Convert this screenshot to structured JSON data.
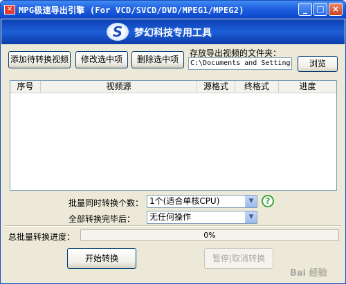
{
  "window": {
    "icon_glyph": "✕",
    "title": "MPG极速导出引擎 (For VCD/SVCD/DVD/MPEG1/MPEG2)",
    "minimize_glyph": "_",
    "maximize_glyph": "□",
    "close_glyph": "×"
  },
  "banner": {
    "logo_glyph": "S",
    "text": "梦幻科技专用工具"
  },
  "toolbar": {
    "add_label": "添加待转换视频",
    "edit_label": "修改选中项",
    "delete_label": "删除选中项"
  },
  "output": {
    "folder_label": "存放导出视频的文件夹：",
    "folder_value": "C:\\Documents and Settings",
    "browse_label": "浏览"
  },
  "list": {
    "columns": [
      "序号",
      "视频源",
      "源格式",
      "终格式",
      "进度"
    ],
    "rows": []
  },
  "options": {
    "concurrent_label": "批量同时转换个数：",
    "concurrent_value": "1个(适合单核CPU)",
    "after_label": "全部转换完毕后：",
    "after_value": "无任何操作",
    "help_glyph": "?"
  },
  "progress": {
    "label": "总批量转换进度：",
    "value_text": "0%",
    "value": 0
  },
  "actions": {
    "start_label": "开始转换",
    "pause_label": "暂停|取消转换"
  },
  "watermark": "Bai 经验",
  "colors": {
    "titlebar": "#1f5fe0",
    "banner": "#1e5fd8",
    "dialog_bg": "#ece9d8",
    "help_green": "#3aa637"
  },
  "icons": {
    "app": "app-icon",
    "logo": "s-logo-icon",
    "help": "help-icon",
    "dropdown": "chevron-down-icon"
  }
}
